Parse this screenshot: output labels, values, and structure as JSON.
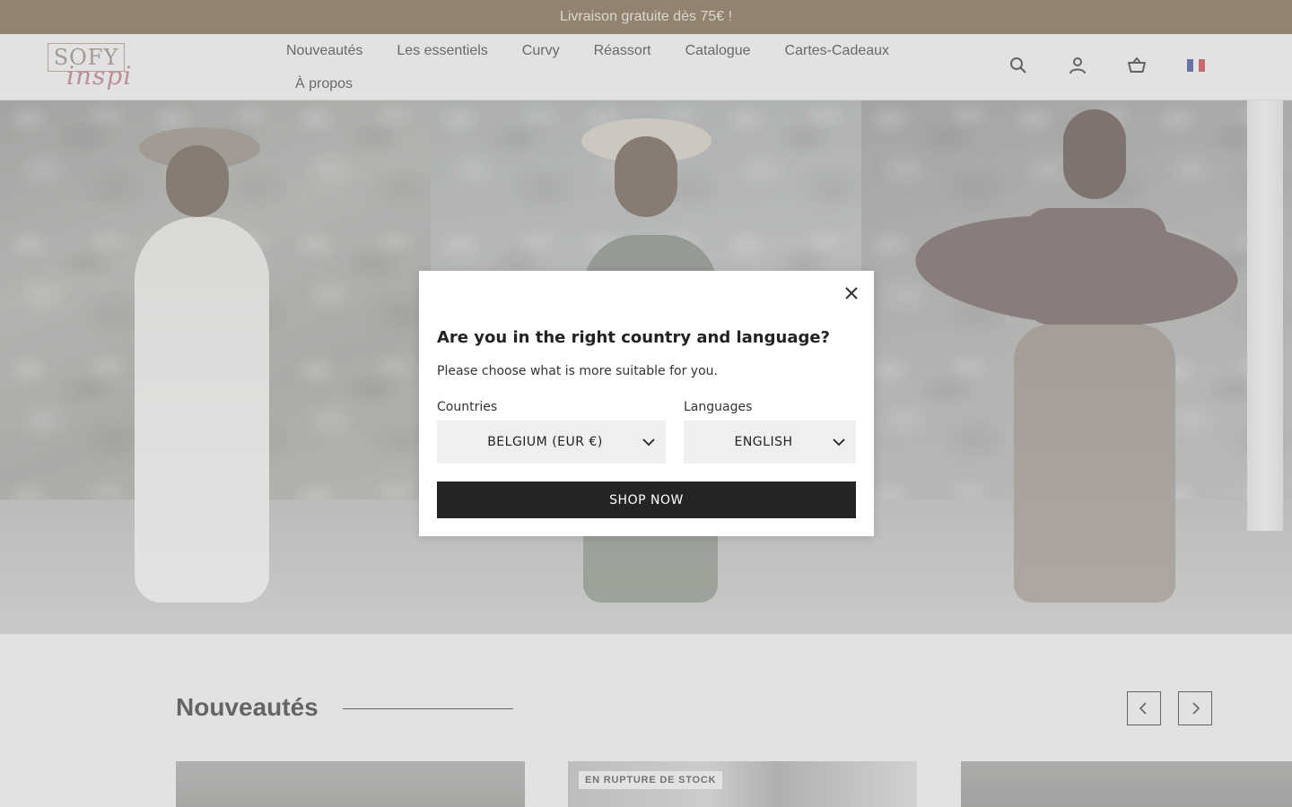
{
  "announcement": {
    "text": "Livraison gratuite dès 75€ !"
  },
  "header": {
    "logo": {
      "top": "SOFY",
      "bottom": "inspi"
    },
    "nav": [
      {
        "label": "Nouveautés"
      },
      {
        "label": "Les essentiels"
      },
      {
        "label": "Curvy"
      },
      {
        "label": "Réassort"
      },
      {
        "label": "Catalogue"
      },
      {
        "label": "Cartes-Cadeaux"
      },
      {
        "label": "À propos"
      }
    ],
    "icons": [
      "search-icon",
      "account-icon",
      "cart-icon",
      "flag-fr-icon"
    ]
  },
  "section": {
    "title": "Nouveautés",
    "badge": "EN RUPTURE DE STOCK"
  },
  "modal": {
    "title": "Are you in the right country and language?",
    "subtitle": "Please choose what is more suitable for you.",
    "countries_label": "Countries",
    "country_value": "BELGIUM (EUR €)",
    "languages_label": "Languages",
    "language_value": "ENGLISH",
    "button": "SHOP NOW"
  },
  "colors": {
    "announcement_bg": "#6e5231",
    "announcement_text": "#f1ead9",
    "button_bg": "#222426",
    "select_bg": "#efefef"
  }
}
